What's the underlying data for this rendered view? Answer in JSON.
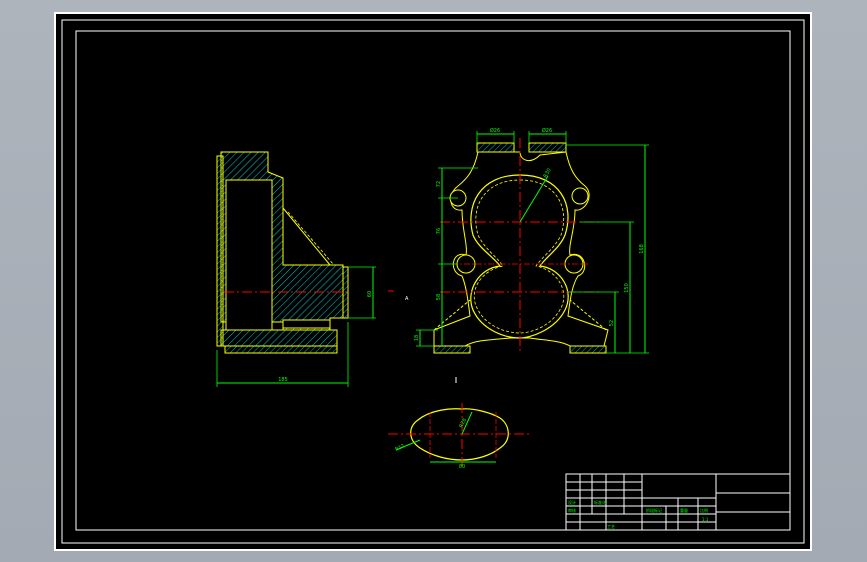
{
  "app": {
    "title": "",
    "colors": {
      "background": "#a9b0b8",
      "paper": "#000000",
      "border": "#ffffff",
      "outline": "#ffff00",
      "dimension": "#00ff00",
      "centerline": "#ff0000",
      "hatch": "#00ffff",
      "text_green": "#00ff00"
    }
  },
  "views": {
    "side": {
      "width_dim": "185",
      "height_dim": "60"
    },
    "front": {
      "top_dim_left": "Ø26",
      "top_dim_right": "Ø26",
      "radius_dim": "R30",
      "left_dims": [
        "72",
        "76",
        "58",
        "18"
      ],
      "right_dims": [
        "168",
        "150",
        "52"
      ],
      "small_mark": "A"
    },
    "section": {
      "radius_dim": "R28",
      "left_dim": "R12",
      "bottom_dim": "80"
    }
  },
  "title_block": {
    "rows": [
      "设计",
      "标准化",
      "审核",
      "工艺"
    ],
    "labels": [
      "阶段标记",
      "重量",
      "比例"
    ],
    "scale": "1:1"
  }
}
